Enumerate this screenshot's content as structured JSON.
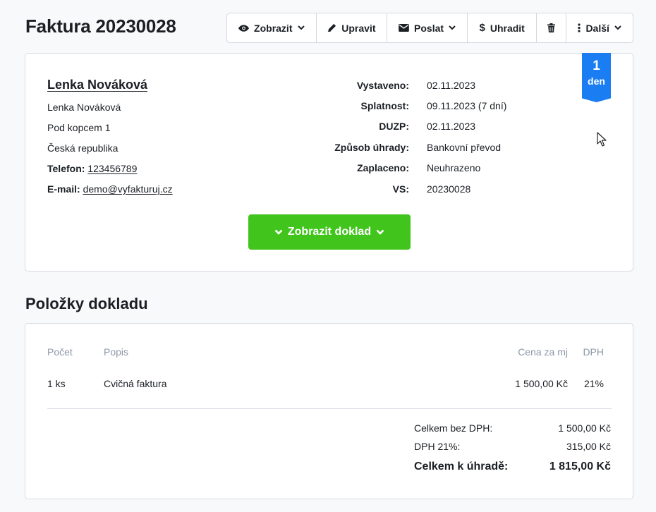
{
  "header": {
    "title": "Faktura 20230028"
  },
  "toolbar": {
    "view_label": "Zobrazit",
    "edit_label": "Upravit",
    "send_label": "Poslat",
    "pay_label": "Uhradit",
    "more_label": "Další"
  },
  "client": {
    "name": "Lenka Nováková",
    "contact_name": "Lenka Nováková",
    "street": "Pod kopcem 1",
    "country": "Česká republika",
    "phone_label": "Telefon:",
    "phone": "123456789",
    "email_label": "E-mail:",
    "email": "demo@vyfakturuj.cz"
  },
  "meta": [
    {
      "label": "Vystaveno:",
      "value": "02.11.2023"
    },
    {
      "label": "Splatnost:",
      "value": "09.11.2023 (7 dní)"
    },
    {
      "label": "DUZP:",
      "value": "02.11.2023"
    },
    {
      "label": "Způsob úhrady:",
      "value": "Bankovní převod"
    },
    {
      "label": "Zaplaceno:",
      "value": "Neuhrazeno"
    },
    {
      "label": "VS:",
      "value": "20230028"
    }
  ],
  "ribbon": {
    "number": "1",
    "unit": "den",
    "color": "#1a7ef2"
  },
  "show_document_label": "Zobrazit doklad",
  "items_section": {
    "title": "Položky dokladu",
    "columns": {
      "quantity": "Počet",
      "description": "Popis",
      "unit_price": "Cena za mj",
      "vat": "DPH"
    },
    "rows": [
      {
        "quantity": "1 ks",
        "description": "Cvičná faktura",
        "unit_price": "1 500,00 Kč",
        "vat": "21%"
      }
    ],
    "summary": [
      {
        "label": "Celkem bez DPH:",
        "value": "1 500,00 Kč"
      },
      {
        "label": "DPH 21%:",
        "value": "315,00 Kč"
      },
      {
        "label": "Celkem k úhradě:",
        "value": "1 815,00 Kč"
      }
    ]
  },
  "colors": {
    "accent_green": "#41c51c",
    "accent_blue": "#1a7ef2",
    "muted_text": "#8e98a8"
  }
}
